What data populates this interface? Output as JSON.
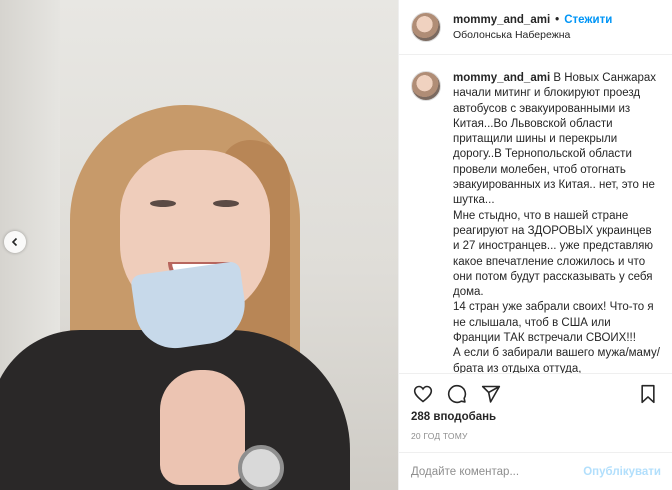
{
  "post": {
    "username": "mommy_and_ami",
    "dot": "•",
    "follow_label": "Стежити",
    "location": "Оболонська Набережна"
  },
  "caption": {
    "username": "mommy_and_ami",
    "text": " В Новых Санжарах начали митинг и блокируют проезд автобусов с эвакуированными из Китая...Во Львовской области притащили шины и перекрыли дорогу..В Тернопольской области провели молебен, чтоб отогнать эвакуированных из Китая.. нет, это не шутка...\nМне стыдно, что в нашей стране реагируют на ЗДОРОВЫХ украинцев и 27 иностранцев... уже представляю какое впечатление сложилось и что они потом будут рассказывать у себя дома.\n14 стран уже забрали своих! Что-то я не слышала, чтоб в США или Франции ТАК встречали СВОИХ!!!\nА если б забирали вашего мужа/маму/брата из отдыха оттуда,"
  },
  "actions": {
    "icons": [
      "heart-icon",
      "comment-icon",
      "share-icon",
      "bookmark-icon"
    ]
  },
  "likes_label": "288 вподобань",
  "time_label": "20 ГОД ТОМУ",
  "comment": {
    "placeholder": "Додайте коментар...",
    "post_label": "Опублікувати"
  },
  "colors": {
    "accent": "#0095f6",
    "post_disabled": "#b2dffc",
    "muted": "#8e8e8e",
    "border": "#efefef"
  }
}
